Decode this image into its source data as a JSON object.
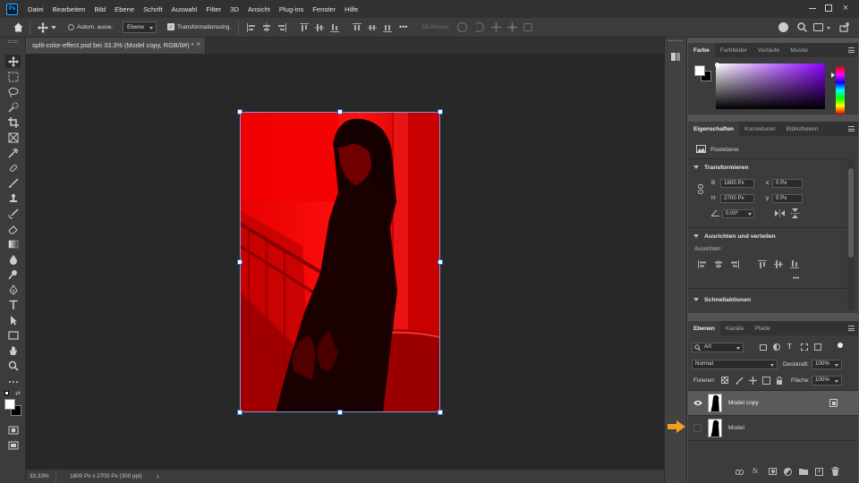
{
  "app": {
    "logo": "Ps"
  },
  "menu": [
    "Datei",
    "Bearbeiten",
    "Bild",
    "Ebene",
    "Schrift",
    "Auswahl",
    "Filter",
    "3D",
    "Ansicht",
    "Plug-ins",
    "Fenster",
    "Hilfe"
  ],
  "options": {
    "auto_select_label": "Autom. ausw.:",
    "auto_select_value": "Ebene",
    "transform_controls_label": "Transformationsstrg.",
    "mode_3d": "3D-Modus:"
  },
  "document": {
    "tab_title": "split-color-effect.psd bei 33.3% (Model copy, RGB/8#) *",
    "close": "×"
  },
  "status": {
    "zoom": "33.33%",
    "doc_info": "1800 Px x 2700 Px (300 ppi)",
    "arrow": "›"
  },
  "colors": {
    "accent": "#2c6cc8",
    "arrow": "#f0a020",
    "canvas_red": "#ff0000"
  },
  "color_panel": {
    "tabs": [
      "Farbe",
      "Farbfelder",
      "Verläufe",
      "Muster"
    ],
    "active": "Farbe"
  },
  "properties_panel": {
    "tabs": [
      "Eigenschaften",
      "Korrekturen",
      "Bibliotheken"
    ],
    "layer_type": "Pixelebene",
    "transform": {
      "title": "Transformieren",
      "w_label": "B",
      "w": "1800 Px",
      "h_label": "H",
      "h": "2700 Px",
      "x_label": "x",
      "x": "0 Px",
      "y_label": "y",
      "y": "0 Px",
      "angle": "0.00°"
    },
    "align": {
      "title": "Ausrichten und verteilen",
      "sub": "Ausrichten:",
      "more": "•••"
    },
    "quick": {
      "title": "Schnellaktionen"
    }
  },
  "layers_panel": {
    "tabs": [
      "Ebenen",
      "Kanäle",
      "Pfade"
    ],
    "filter": "Art",
    "blend_mode": "Normal",
    "opacity_label": "Deckkraft:",
    "opacity": "100%",
    "lock_label": "Fixieren:",
    "fill_label": "Fläche:",
    "fill": "100%",
    "layers": [
      {
        "name": "Model copy",
        "visible": true,
        "selected": true
      },
      {
        "name": "Model",
        "visible": false,
        "selected": false
      }
    ]
  }
}
